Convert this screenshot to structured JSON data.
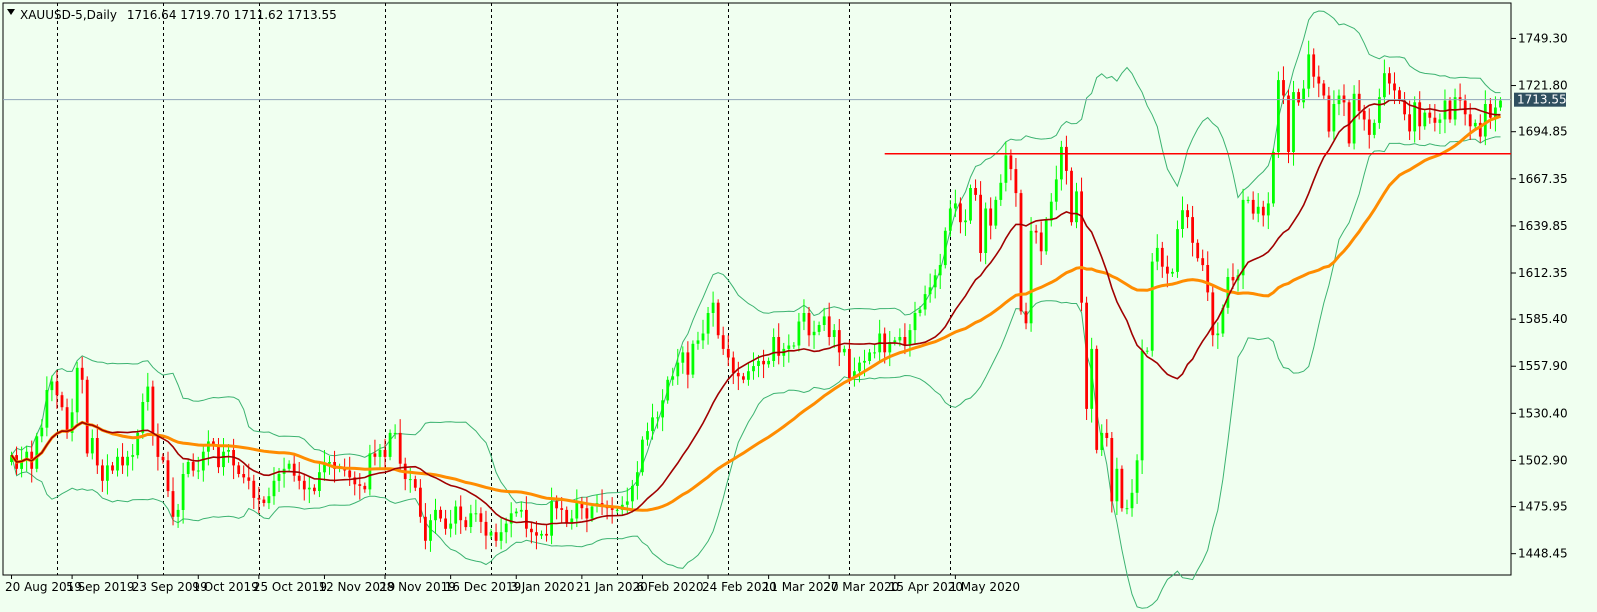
{
  "header": {
    "symbol": "XAUUSD-5,Daily",
    "ohlc": "1716.64 1719.70 1711.62 1713.55"
  },
  "colors": {
    "background": "#f0fff0",
    "bull": "#00ff00",
    "bear": "#ff0000",
    "ma_fast": "#a00000",
    "ma_slow": "#ff8c00",
    "bands": "#3cb371",
    "support_line": "#ff0000",
    "price_line": "#8fa4b8",
    "price_label_bg": "#2f4f5f"
  },
  "chart_data": {
    "type": "candlestick",
    "title": "XAUUSD-5,Daily",
    "current_price": 1713.55,
    "current_price_label": "1713.55",
    "ylim": [
      1436,
      1770
    ],
    "yticks": [
      "1749.30",
      "1721.80",
      "1694.85",
      "1667.35",
      "1639.85",
      "1612.35",
      "1585.40",
      "1557.90",
      "1530.40",
      "1502.90",
      "1475.95",
      "1448.45"
    ],
    "x_labels": [
      "20 Aug 2019",
      "5 Sep 2019",
      "23 Sep 2019",
      "9 Oct 2019",
      "25 Oct 2019",
      "12 Nov 2019",
      "28 Nov 2019",
      "16 Dec 2019",
      "3 Jan 2020",
      "21 Jan 2020",
      "6 Feb 2020",
      "24 Feb 2020",
      "11 Mar 2020",
      "27 Mar 2020",
      "15 Apr 2020",
      "1 May 2020"
    ],
    "x_label_index": [
      0,
      12,
      25,
      37,
      49,
      62,
      74,
      87,
      100,
      113,
      125,
      138,
      150,
      162,
      175,
      187
    ],
    "period_separators_index": [
      9,
      30,
      49,
      74,
      95,
      120,
      142,
      166,
      186
    ],
    "support_level": 1682,
    "support_start_index": 173,
    "candles_close": [
      1506,
      1498,
      1503,
      1508,
      1498,
      1517,
      1522,
      1544,
      1549,
      1541,
      1534,
      1519,
      1531,
      1557,
      1550,
      1507,
      1516,
      1500,
      1491,
      1500,
      1497,
      1505,
      1500,
      1505,
      1506,
      1519,
      1537,
      1546,
      1518,
      1505,
      1503,
      1485,
      1470,
      1474,
      1495,
      1502,
      1497,
      1497,
      1508,
      1514,
      1511,
      1499,
      1508,
      1509,
      1500,
      1495,
      1493,
      1491,
      1481,
      1480,
      1478,
      1482,
      1491,
      1495,
      1498,
      1501,
      1494,
      1491,
      1486,
      1487,
      1485,
      1496,
      1501,
      1502,
      1498,
      1499,
      1497,
      1493,
      1489,
      1488,
      1486,
      1507,
      1505,
      1509,
      1505,
      1519,
      1519,
      1501,
      1492,
      1492,
      1487,
      1470,
      1456,
      1468,
      1474,
      1469,
      1463,
      1466,
      1476,
      1468,
      1464,
      1472,
      1472,
      1467,
      1459,
      1461,
      1456,
      1461,
      1466,
      1472,
      1473,
      1474,
      1463,
      1461,
      1459,
      1460,
      1459,
      1479,
      1475,
      1474,
      1466,
      1469,
      1478,
      1475,
      1469,
      1476,
      1478,
      1476,
      1475,
      1474,
      1474,
      1477,
      1479,
      1488,
      1496,
      1515,
      1520,
      1528,
      1528,
      1538,
      1550,
      1552,
      1560,
      1566,
      1553,
      1571,
      1573,
      1577,
      1589,
      1595,
      1576,
      1568,
      1563,
      1554,
      1552,
      1550,
      1555,
      1558,
      1561,
      1559,
      1561,
      1575,
      1564,
      1568,
      1570,
      1570,
      1584,
      1589,
      1576,
      1578,
      1582,
      1587,
      1575,
      1579,
      1566,
      1568,
      1551,
      1555,
      1560,
      1561,
      1566,
      1566,
      1577,
      1566,
      1572,
      1573,
      1575,
      1570,
      1579,
      1589,
      1591,
      1600,
      1604,
      1611,
      1617,
      1637,
      1650,
      1653,
      1642,
      1643,
      1662,
      1658,
      1624,
      1650,
      1640,
      1655,
      1665,
      1681,
      1673,
      1659,
      1590,
      1583,
      1637,
      1636,
      1625,
      1643,
      1654,
      1667,
      1686,
      1672,
      1642,
      1660,
      1595,
      1533,
      1568,
      1509,
      1519,
      1516,
      1479,
      1498,
      1475,
      1475,
      1484,
      1503,
      1567,
      1567,
      1619,
      1627,
      1616,
      1612,
      1613,
      1638,
      1649,
      1645,
      1630,
      1621,
      1617,
      1601,
      1576,
      1577,
      1592,
      1610,
      1608,
      1611,
      1655,
      1655,
      1647,
      1651,
      1646,
      1653,
      1683,
      1725,
      1716,
      1683,
      1718,
      1712,
      1720,
      1740,
      1727,
      1723,
      1716,
      1695,
      1711,
      1716,
      1712,
      1688,
      1717,
      1707,
      1702,
      1693,
      1700,
      1715,
      1729,
      1723,
      1719,
      1713,
      1705,
      1695,
      1712,
      1698,
      1706,
      1703,
      1700,
      1702,
      1713,
      1702,
      1715,
      1713,
      1705,
      1698,
      1700,
      1692,
      1711,
      1703,
      1709,
      1713
    ],
    "series": [
      {
        "name": "",
        "kind": "ma_fast",
        "period": 20
      },
      {
        "name": "",
        "kind": "ma_slow",
        "period": 50
      },
      {
        "name": "",
        "kind": "bollinger",
        "period": 20,
        "deviations": 2
      }
    ]
  }
}
